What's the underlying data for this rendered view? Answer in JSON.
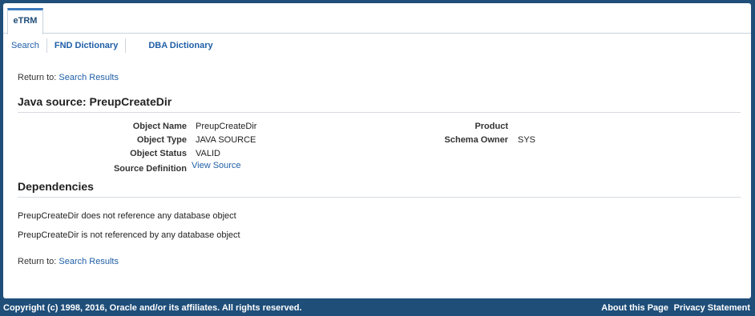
{
  "tabs": [
    {
      "label": "eTRM"
    }
  ],
  "subnav": {
    "search": "Search",
    "fnd": "FND Dictionary",
    "dba": "DBA Dictionary"
  },
  "return_label": "Return to:",
  "return_link": "Search Results",
  "title": "Java source: PreupCreateDir",
  "details": {
    "object_name_label": "Object Name",
    "object_name": "PreupCreateDir",
    "object_type_label": "Object Type",
    "object_type": "JAVA SOURCE",
    "object_status_label": "Object Status",
    "object_status": "VALID",
    "source_definition_label": "Source Definition",
    "source_definition_link": "View Source",
    "product_label": "Product",
    "product": "",
    "schema_owner_label": "Schema Owner",
    "schema_owner": "SYS"
  },
  "dependencies": {
    "heading": "Dependencies",
    "references": "PreupCreateDir does not reference any database object",
    "referenced_by": "PreupCreateDir is not referenced by any database object"
  },
  "footer": {
    "copyright": "Copyright (c) 1998, 2016, Oracle and/or its affiliates. All rights reserved.",
    "about": "About this Page",
    "privacy": "Privacy Statement"
  }
}
